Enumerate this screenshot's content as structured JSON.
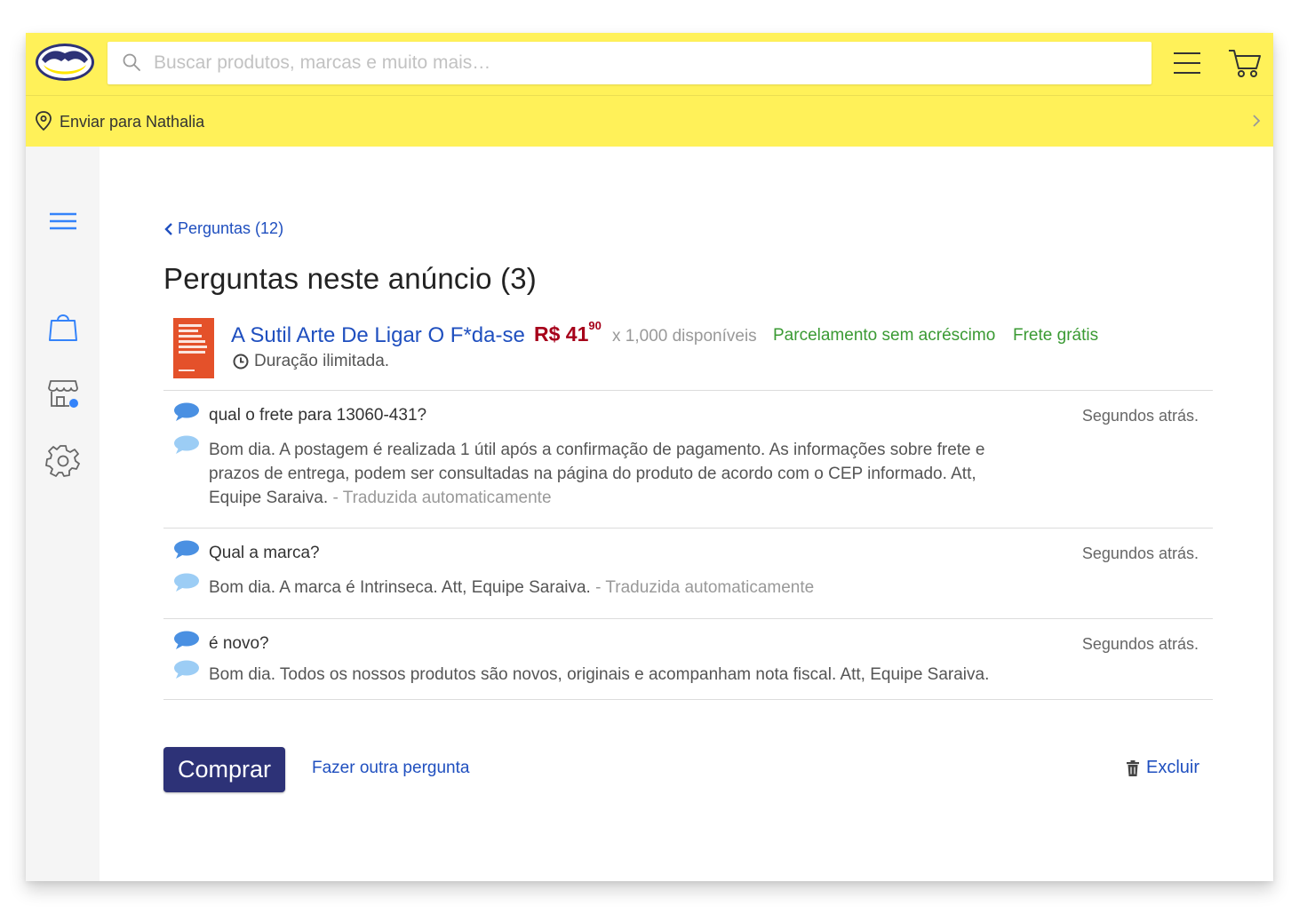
{
  "header": {
    "search_placeholder": "Buscar produtos, marcas e muito mais…",
    "ship_to": "Enviar para Nathalia",
    "brand_color": "#fff159"
  },
  "sidebar": {
    "items": [
      {
        "icon": "menu-icon"
      },
      {
        "icon": "shopping-bag-icon"
      },
      {
        "icon": "store-icon"
      },
      {
        "icon": "gear-icon"
      }
    ]
  },
  "main": {
    "back_link": "Perguntas (12)",
    "title": "Perguntas neste anúncio (3)",
    "product": {
      "title": "A Sutil Arte De Ligar O F*da-se",
      "price_main": "R$ 41",
      "price_cents": "90",
      "availability": "x 1,000 disponíveis",
      "installments": "Parcelamento sem acréscimo",
      "shipping": "Frete grátis",
      "duration": "Duração ilimitada."
    },
    "questions": [
      {
        "question": "qual o frete para 13060-431?",
        "time": "Segundos atrás.",
        "answer": "Bom dia. A postagem é realizada 1 útil após a confirmação de pagamento. As informações sobre frete e prazos de entrega, podem ser consultadas na página do produto de acordo com o CEP informado. Att, Equipe Saraiva.",
        "translated": "- Traduzida automaticamente"
      },
      {
        "question": "Qual a marca?",
        "time": "Segundos atrás.",
        "answer": "Bom dia. A marca é Intrinseca. Att, Equipe Saraiva.",
        "translated": "- Traduzida automaticamente"
      },
      {
        "question": "é novo?",
        "time": "Segundos atrás.",
        "answer": "Bom dia. Todos os nossos produtos são novos, originais e acompanham nota fiscal. Att, Equipe Saraiva.",
        "translated": ""
      }
    ],
    "buy_label": "Comprar",
    "ask_label": "Fazer outra pergunta",
    "delete_label": "Excluir"
  }
}
